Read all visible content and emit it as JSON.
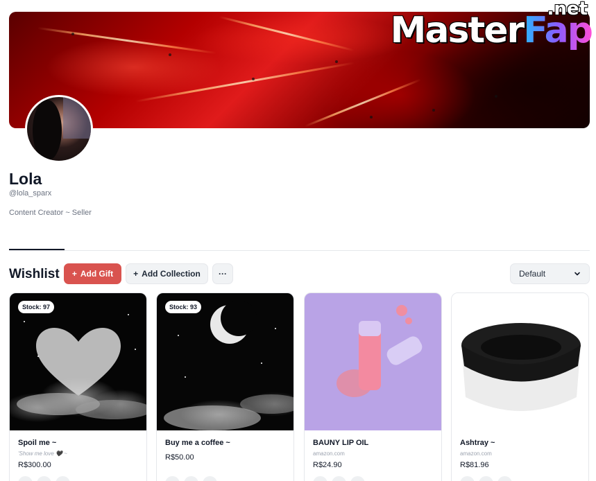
{
  "watermark": {
    "brand_main": "Master",
    "brand_accent": "Fap",
    "brand_suffix": ".net"
  },
  "profile": {
    "name": "Lola",
    "handle": "@lola_sparx",
    "bio": "Content Creator ~ Seller"
  },
  "wishlist": {
    "title": "Wishlist",
    "add_gift_label": "Add Gift",
    "add_collection_label": "Add Collection",
    "more_label": "···",
    "sort_value": "Default"
  },
  "items": [
    {
      "stock": "Stock: 97",
      "title": "Spoil me ~",
      "subtitle": "'Show me love 🖤 ~",
      "price": "R$300.00",
      "image": "heart-clouds-night"
    },
    {
      "stock": "Stock: 93",
      "title": "Buy me a coffee ~",
      "price": "R$50.00",
      "image": "crescent-moon-clouds"
    },
    {
      "title": "BAUNY LIP OIL",
      "source": "amazon.com",
      "price": "R$24.90",
      "image": "lip-oil-bottle"
    },
    {
      "title": "Ashtray ~",
      "source": "amazon.com",
      "price": "R$81.96",
      "image": "black-ashtray"
    }
  ],
  "colors": {
    "primary_button": "#d9534f",
    "neutral_button": "#f1f3f5",
    "text": "#111827",
    "muted": "#6b7280"
  }
}
